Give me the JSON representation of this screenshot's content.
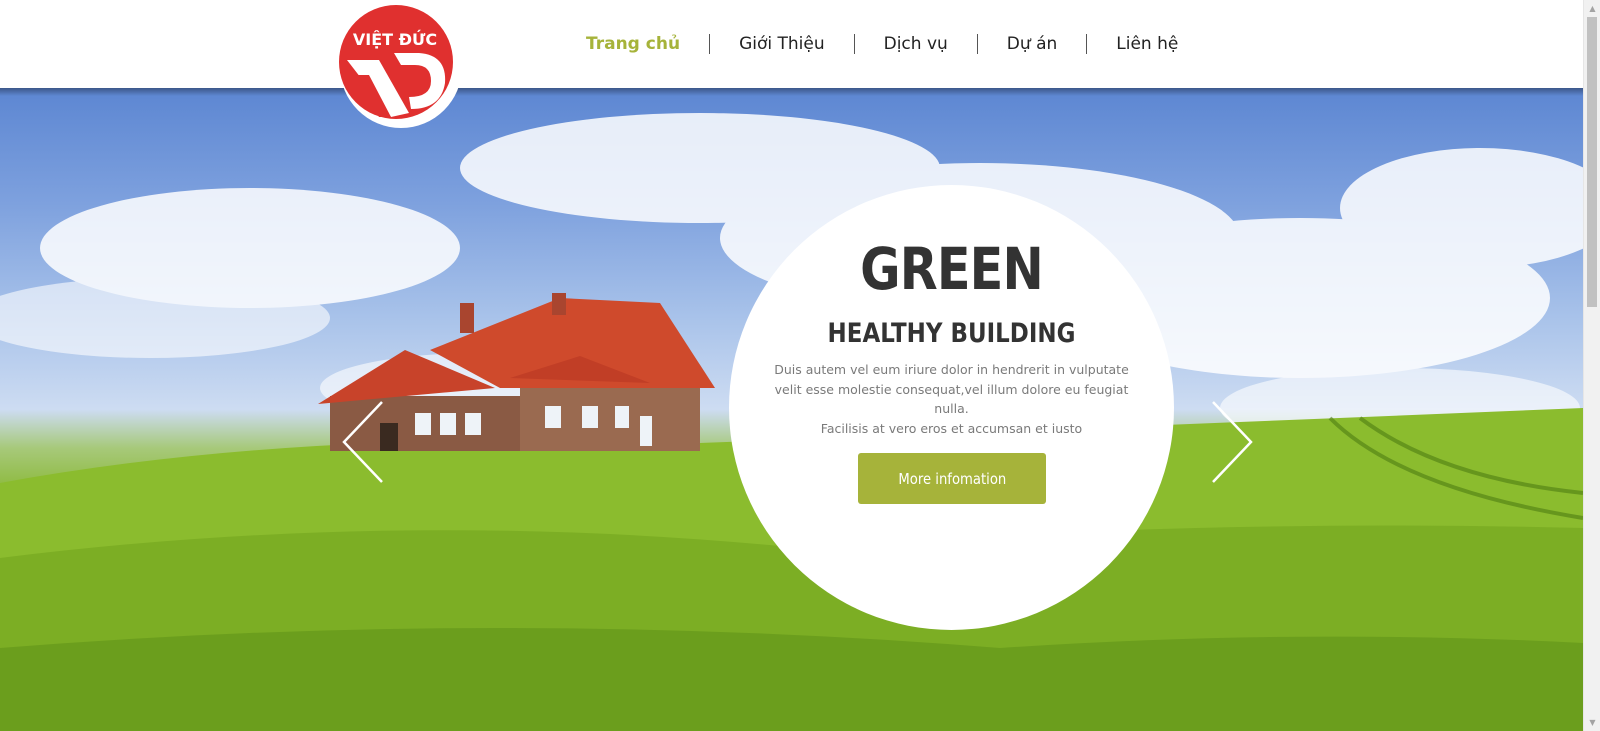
{
  "logo": {
    "text": "VIỆT ĐỨC",
    "mark": "VD"
  },
  "nav": {
    "items": [
      {
        "label": "Trang chủ",
        "active": true
      },
      {
        "label": "Giới Thiệu",
        "active": false
      },
      {
        "label": "Dịch vụ",
        "active": false
      },
      {
        "label": "Dự án",
        "active": false
      },
      {
        "label": "Liên hệ",
        "active": false
      }
    ]
  },
  "hero": {
    "title": "GREEN",
    "subtitle": "HEALTHY BUILDING",
    "body_line1": "Duis autem vel eum iriure dolor in hendrerit in vulputate velit esse molestie consequat,vel illum dolore eu feugiat nulla.",
    "body_line2": "Facilisis at vero eros et accumsan et iusto",
    "button_label": "More infomation",
    "prev_icon": "chevron-left-icon",
    "next_icon": "chevron-right-icon"
  },
  "colors": {
    "accent": "#a6b33a",
    "logo_red": "#e0302f",
    "text_dark": "#333333"
  }
}
